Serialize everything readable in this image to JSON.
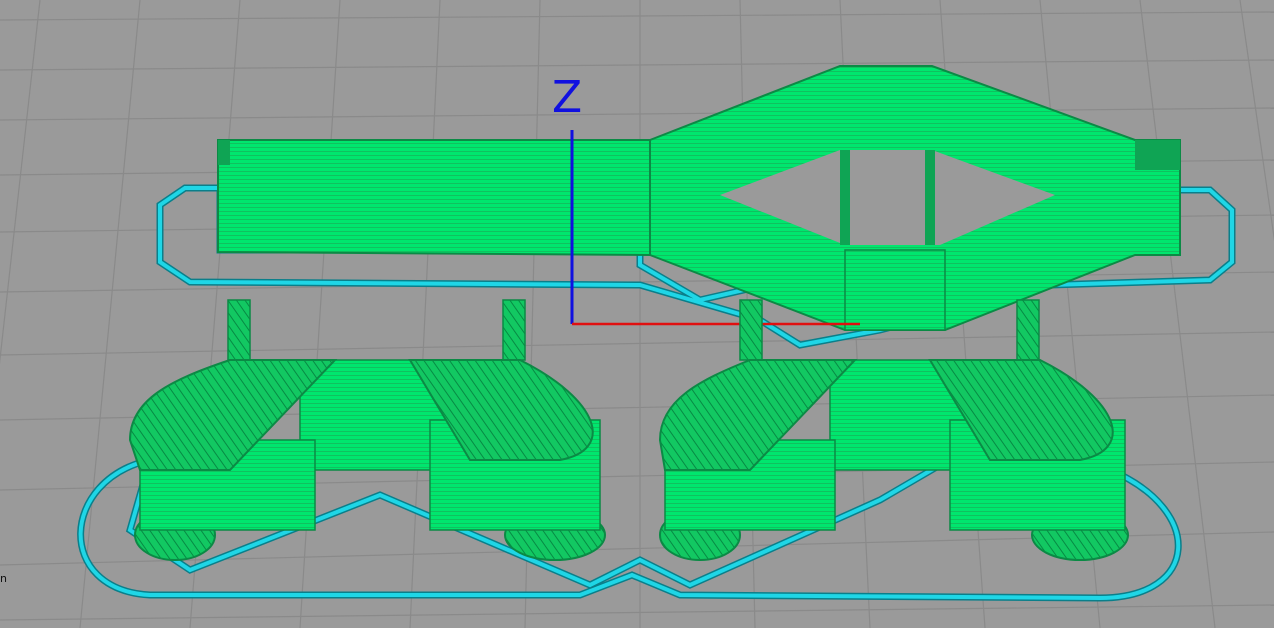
{
  "viewport": {
    "axis_label_z": "Z",
    "edge_text": "n",
    "colors": {
      "background": "#9a9a9a",
      "grid": "#8c8c8c",
      "grid_major": "#7f7f7f",
      "model_fill": "#00e66e",
      "model_line": "#0b8a45",
      "skirt": "#1fd6e6",
      "skirt_outline": "#0a7f8a",
      "axis_x": "#e01010",
      "axis_z": "#1010e0"
    }
  }
}
